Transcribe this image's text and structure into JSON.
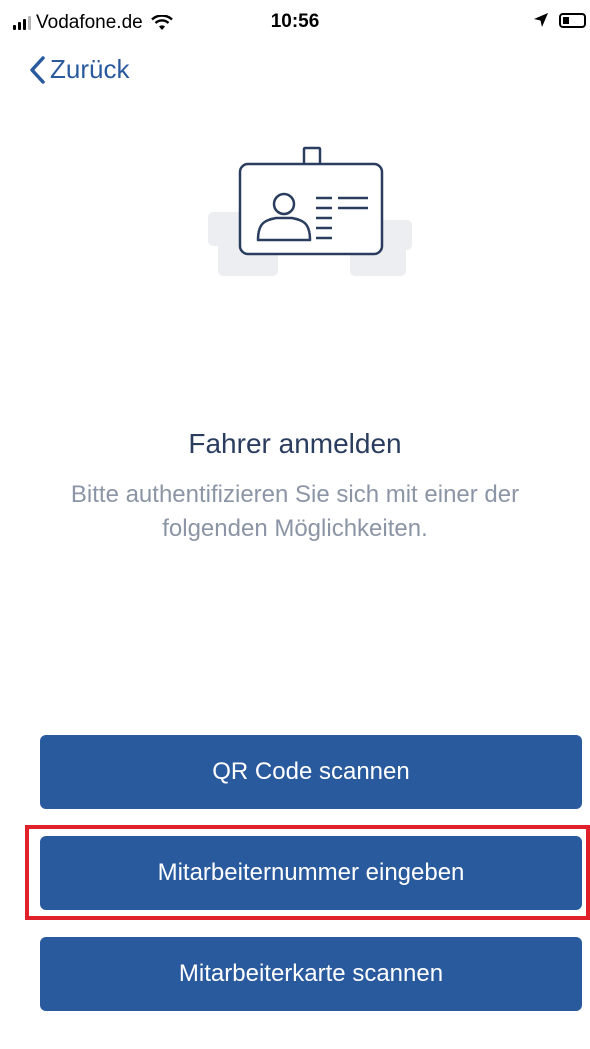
{
  "status_bar": {
    "carrier": "Vodafone.de",
    "time": "10:56"
  },
  "nav": {
    "back_label": "Zurück"
  },
  "content": {
    "title": "Fahrer anmelden",
    "subtitle": "Bitte authentifizieren Sie sich mit einer der folgenden Möglichkeiten."
  },
  "buttons": {
    "qr_label": "QR Code scannen",
    "number_label": "Mitarbeiternummer eingeben",
    "card_label": "Mitarbeiterkarte scannen"
  },
  "icons": {
    "illustration": "id-badge-icon"
  },
  "colors": {
    "accent": "#2a5a9e",
    "highlight": "#e0202a",
    "title": "#2a3d5e",
    "subtitle": "#8b95a5"
  }
}
